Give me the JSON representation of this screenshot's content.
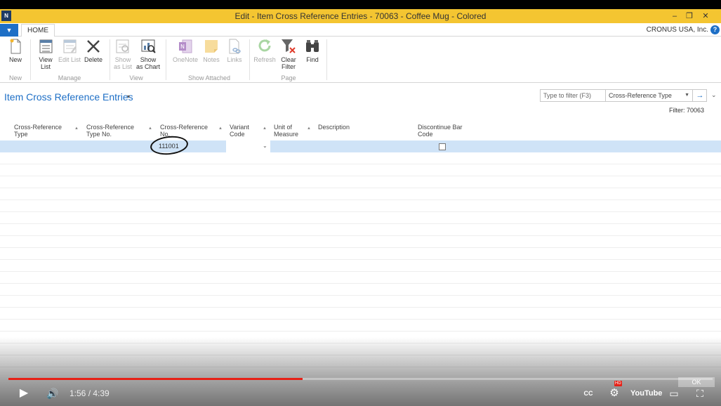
{
  "window": {
    "logo_text": "N",
    "title": "Edit - Item Cross Reference Entries - 70063 - Coffee Mug - Colored",
    "minimize": "–",
    "restore": "❐",
    "close": "✕"
  },
  "tabs": {
    "file_caret": "▼",
    "home": "HOME",
    "company": "CRONUS USA, Inc.",
    "help": "?"
  },
  "ribbon": {
    "new": "New",
    "group_new": "New",
    "view_list": "View List",
    "edit_list": "Edit List",
    "delete": "Delete",
    "group_manage": "Manage",
    "show_as_list": "Show as List",
    "show_as_chart": "Show as Chart",
    "group_view": "View",
    "onenote": "OneNote",
    "notes": "Notes",
    "links": "Links",
    "group_show_attached": "Show Attached",
    "refresh": "Refresh",
    "clear_filter": "Clear Filter",
    "find": "Find",
    "group_page": "Page"
  },
  "page": {
    "title": "Item Cross Reference Entries",
    "title_caret": "▾",
    "filter_placeholder": "Type to filter (F3)",
    "filter_field": "Cross-Reference Type",
    "filter_field_caret": "▼",
    "filter_go": "→",
    "expand_caret": "⌄",
    "filter_label": "Filter: 70063"
  },
  "grid": {
    "columns": [
      "Cross-Reference Type",
      "Cross-Reference Type No.",
      "Cross-Reference No.",
      "Variant Code",
      "Unit of Measure",
      "Description",
      "Discontinue Bar Code"
    ],
    "sort_arrow": "▲",
    "row": {
      "cross_reference_no": "111001",
      "variant_caret": "⌄",
      "discontinue_bar_code": false
    }
  },
  "video": {
    "play": "▶",
    "volume": "🔊",
    "time": "1:56 / 4:39",
    "progress": 0.418,
    "cc": "CC",
    "settings": "⚙",
    "hd": "HD",
    "youtube": "YouTube",
    "cast": "▭",
    "fullscreen": "⛶",
    "ok_hint": "OK"
  }
}
